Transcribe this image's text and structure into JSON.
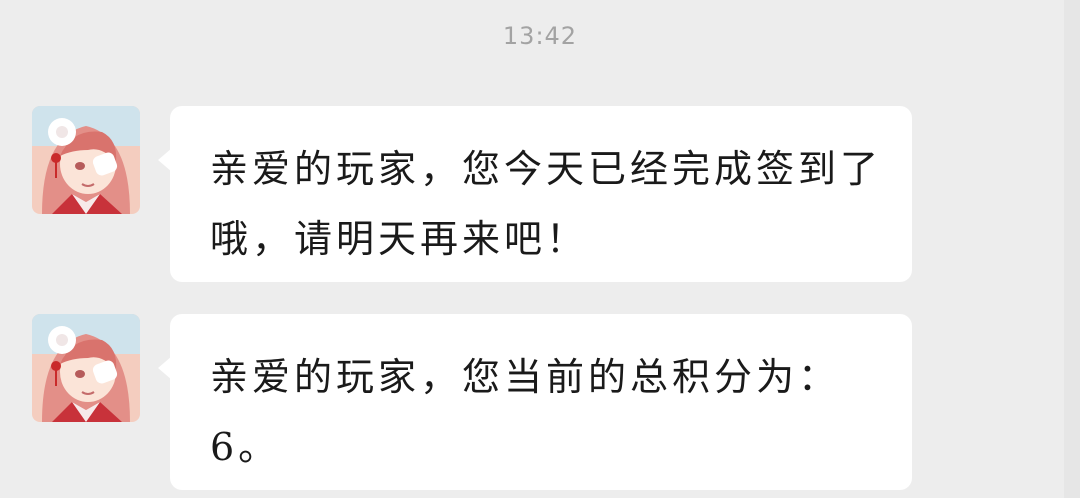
{
  "chat": {
    "timestamp": "13:42",
    "messages": [
      {
        "avatar_icon": "anime-girl-avatar-icon",
        "text": "亲爱的玩家，您今天已经完成签到了哦，请明天再来吧！"
      },
      {
        "avatar_icon": "anime-girl-avatar-icon",
        "text": "亲爱的玩家，您当前的总积分为：6。"
      }
    ]
  },
  "colors": {
    "background": "#ededed",
    "bubble": "#ffffff",
    "timestamp": "#a3a3a3",
    "text": "#1a1a1a"
  }
}
